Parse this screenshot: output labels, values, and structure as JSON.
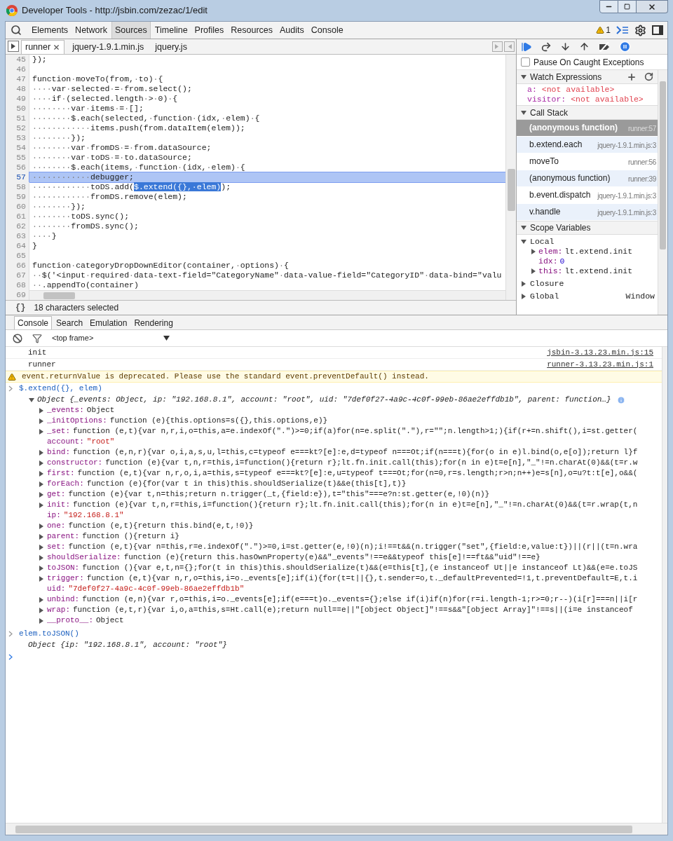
{
  "window": {
    "title": "Developer Tools - http://jsbin.com/zezac/1/edit"
  },
  "panel_tabs": [
    {
      "label": "Elements",
      "selected": false
    },
    {
      "label": "Network",
      "selected": false
    },
    {
      "label": "Sources",
      "selected": true
    },
    {
      "label": "Timeline",
      "selected": false
    },
    {
      "label": "Profiles",
      "selected": false
    },
    {
      "label": "Resources",
      "selected": false
    },
    {
      "label": "Audits",
      "selected": false
    },
    {
      "label": "Console",
      "selected": false
    }
  ],
  "warning_count": "1",
  "file_tabs": [
    {
      "label": "runner",
      "selected": true,
      "closable": true
    },
    {
      "label": "jquery-1.9.1.min.js",
      "selected": false,
      "closable": false
    },
    {
      "label": "jquery.js",
      "selected": false,
      "closable": false
    }
  ],
  "code_lines": [
    {
      "num": "45",
      "text": "});",
      "current": false
    },
    {
      "num": "46",
      "current": false
    },
    {
      "num": "47",
      "text": "function·moveTo(from,·to)·{",
      "current": false
    },
    {
      "num": "48",
      "text": "····var·selected·=·from.select();",
      "current": false
    },
    {
      "num": "49",
      "text": "····if·(selected.length·>·0)·{",
      "current": false
    },
    {
      "num": "50",
      "text": "········var·items·=·[];",
      "current": false
    },
    {
      "num": "51",
      "text": "········$.each(selected,·function·(idx,·elem)·{",
      "current": false
    },
    {
      "num": "52",
      "text": "············items.push(from.dataItem(elem));",
      "current": false
    },
    {
      "num": "53",
      "text": "········});",
      "current": false
    },
    {
      "num": "54",
      "text": "········var·fromDS·=·from.dataSource;",
      "current": false
    },
    {
      "num": "55",
      "text": "········var·toDS·=·to.dataSource;",
      "current": false
    },
    {
      "num": "56",
      "text": "········$.each(items,·function·(idx,·elem)·{",
      "current": false
    },
    {
      "num": "57",
      "text": "············debugger;",
      "current": true
    },
    {
      "num": "58",
      "text": "············toDS.add(",
      "selection": "$.extend({},·elem)",
      "after": ");",
      "current": false
    },
    {
      "num": "59",
      "text": "············fromDS.remove(elem);",
      "current": false
    },
    {
      "num": "60",
      "text": "········});",
      "current": false
    },
    {
      "num": "61",
      "text": "········toDS.sync();",
      "current": false
    },
    {
      "num": "62",
      "text": "········fromDS.sync();",
      "current": false
    },
    {
      "num": "63",
      "text": "····}",
      "current": false
    },
    {
      "num": "64",
      "text": "}",
      "current": false
    },
    {
      "num": "65",
      "current": false
    },
    {
      "num": "66",
      "text": "function·categoryDropDownEditor(container,·options)·{",
      "current": false
    },
    {
      "num": "67",
      "text": "··$('<input·required·data-text-field=\"CategoryName\"·data-value-field=\"CategoryID\"·data-bind=\"valu",
      "current": false
    },
    {
      "num": "68",
      "text": "··.appendTo(container)",
      "current": false
    },
    {
      "num": "69",
      "current": false
    }
  ],
  "status_bar": {
    "pretty_print": "{}",
    "text": "18 characters selected"
  },
  "debugger": {
    "pause_on_caught": {
      "label": "Pause On Caught Exceptions",
      "checked": false
    },
    "watch": {
      "title": "Watch Expressions",
      "expanded": true,
      "items": [
        {
          "key": "a:",
          "value": "<not available>"
        },
        {
          "key": "visitor:",
          "value": "<not available>"
        }
      ]
    },
    "call_stack": {
      "title": "Call Stack",
      "expanded": true,
      "frames": [
        {
          "name": "(anonymous function)",
          "location": "runner:57",
          "selected": true
        },
        {
          "name": "b.extend.each",
          "location": "jquery-1.9.1.min.js:3",
          "selected": false
        },
        {
          "name": "moveTo",
          "location": "runner:56",
          "selected": false
        },
        {
          "name": "(anonymous function)",
          "location": "runner:39",
          "selected": false
        },
        {
          "name": "b.event.dispatch",
          "location": "jquery-1.9.1.min.js:3",
          "selected": false
        },
        {
          "name": "v.handle",
          "location": "jquery-1.9.1.min.js:3",
          "selected": false
        }
      ]
    },
    "scope": {
      "title": "Scope Variables",
      "expanded": true,
      "scopes": [
        {
          "name": "Local",
          "expanded": true,
          "children": [
            {
              "key": "elem:",
              "value": "lt.extend.init",
              "expandable": true,
              "kind": "object"
            },
            {
              "key": "idx:",
              "value": "0",
              "expandable": false,
              "kind": "number"
            },
            {
              "key": "this:",
              "value": "lt.extend.init",
              "expandable": true,
              "kind": "object"
            }
          ]
        },
        {
          "name": "Closure",
          "expanded": false
        },
        {
          "name": "Global",
          "value": "Window",
          "expanded": false
        }
      ]
    }
  },
  "drawer_tabs": [
    {
      "label": "Console",
      "selected": true
    },
    {
      "label": "Search",
      "selected": false
    },
    {
      "label": "Emulation",
      "selected": false
    },
    {
      "label": "Rendering",
      "selected": false
    }
  ],
  "console": {
    "context": "<top frame>",
    "messages": [
      {
        "kind": "log",
        "text": "init",
        "source": "jsbin-3.13.23.min.js:15"
      },
      {
        "kind": "log",
        "text": "runner",
        "source": "runner-3.13.23.min.js:1"
      },
      {
        "kind": "warning",
        "text": "event.returnValue is deprecated. Please use the standard event.preventDefault() instead."
      },
      {
        "kind": "input",
        "text": "$.extend({}, elem)"
      },
      {
        "kind": "object",
        "text": "Object {_events: Object, ip: \"192.168.8.1\", account: \"root\", uid: \"7def0f27-4a9c-4c0f-99eb-86ae2effdb1b\", parent: function…}",
        "expanded": true,
        "properties": [
          {
            "key": "_events:",
            "value": "Object",
            "expandable": true,
            "kind": "object"
          },
          {
            "key": "_initOptions:",
            "value": "function (e){this.options=s({},this.options,e)}",
            "expandable": true,
            "kind": "function"
          },
          {
            "key": "_set:",
            "value": "function (e,t){var n,r,i,o=this,a=e.indexOf(\".\")>=0;if(a)for(n=e.split(\".\"),r=\"\";n.length>1;){if(r+=n.shift(),i=st.getter(",
            "expandable": true,
            "kind": "function"
          },
          {
            "key": "account:",
            "value": "\"root\"",
            "expandable": false,
            "kind": "string"
          },
          {
            "key": "bind:",
            "value": "function (e,n,r){var o,i,a,s,u,l=this,c=typeof e===kt?[e]:e,d=typeof n===Ot;if(n===t){for(o in e)l.bind(o,e[o]);return l}f",
            "expandable": true,
            "kind": "function"
          },
          {
            "key": "constructor:",
            "value": "function (e){var t,n,r=this,i=function(){return r};lt.fn.init.call(this);for(n in e)t=e[n],\"_\"!=n.charAt(0)&&(t=r.w",
            "expandable": true,
            "kind": "function"
          },
          {
            "key": "first:",
            "value": "function (e,t){var n,r,o,i,a=this,s=typeof e===kt?[e]:e,u=typeof t===Ot;for(n=0,r=s.length;r>n;n++)e=s[n],o=u?t:t[e],o&&(",
            "expandable": true,
            "kind": "function"
          },
          {
            "key": "forEach:",
            "value": "function (e){for(var t in this)this.shouldSerialize(t)&&e(this[t],t)}",
            "expandable": true,
            "kind": "function"
          },
          {
            "key": "get:",
            "value": "function (e){var t,n=this;return n.trigger(_t,{field:e}),t=\"this\"===e?n:st.getter(e,!0)(n)}",
            "expandable": true,
            "kind": "function"
          },
          {
            "key": "init:",
            "value": "function (e){var t,n,r=this,i=function(){return r};lt.fn.init.call(this);for(n in e)t=e[n],\"_\"!=n.charAt(0)&&(t=r.wrap(t,n",
            "expandable": true,
            "kind": "function"
          },
          {
            "key": "ip:",
            "value": "\"192.168.8.1\"",
            "expandable": false,
            "kind": "string"
          },
          {
            "key": "one:",
            "value": "function (e,t){return this.bind(e,t,!0)}",
            "expandable": true,
            "kind": "function"
          },
          {
            "key": "parent:",
            "value": "function (){return i}",
            "expandable": true,
            "kind": "function"
          },
          {
            "key": "set:",
            "value": "function (e,t){var n=this,r=e.indexOf(\".\")>=0,i=st.getter(e,!0)(n);i!==t&&(n.trigger(\"set\",{field:e,value:t})||(r||(t=n.wra",
            "expandable": true,
            "kind": "function"
          },
          {
            "key": "shouldSerialize:",
            "value": "function (e){return this.hasOwnProperty(e)&&\"_events\"!==e&&typeof this[e]!==ft&&\"uid\"!==e}",
            "expandable": true,
            "kind": "function"
          },
          {
            "key": "toJSON:",
            "value": "function (){var e,t,n={};for(t in this)this.shouldSerialize(t)&&(e=this[t],(e instanceof Ut||e instanceof Lt)&&(e=e.toJS",
            "expandable": true,
            "kind": "function"
          },
          {
            "key": "trigger:",
            "value": "function (e,t){var n,r,o=this,i=o._events[e];if(i){for(t=t||{},t.sender=o,t._defaultPrevented=!1,t.preventDefault=E,t.i",
            "expandable": true,
            "kind": "function"
          },
          {
            "key": "uid:",
            "value": "\"7def0f27-4a9c-4c0f-99eb-86ae2effdb1b\"",
            "expandable": false,
            "kind": "string"
          },
          {
            "key": "unbind:",
            "value": "function (e,n){var r,o=this,i=o._events[e];if(e===t)o._events={};else if(i)if(n)for(r=i.length-1;r>=0;r--)(i[r]===n||i[r",
            "expandable": true,
            "kind": "function"
          },
          {
            "key": "wrap:",
            "value": "function (e,t,r){var i,o,a=this,s=Ht.call(e);return null==e||\"[object Object]\"!==s&&\"[object Array]\"!==s||(i=e instanceof",
            "expandable": true,
            "kind": "function"
          },
          {
            "key": "__proto__:",
            "value": "Object",
            "expandable": true,
            "kind": "object"
          }
        ]
      },
      {
        "kind": "input",
        "text": "elem.toJSON()"
      },
      {
        "kind": "result",
        "text": "Object {ip: \"192.168.8.1\", account: \"root\"}"
      },
      {
        "kind": "prompt"
      }
    ]
  }
}
